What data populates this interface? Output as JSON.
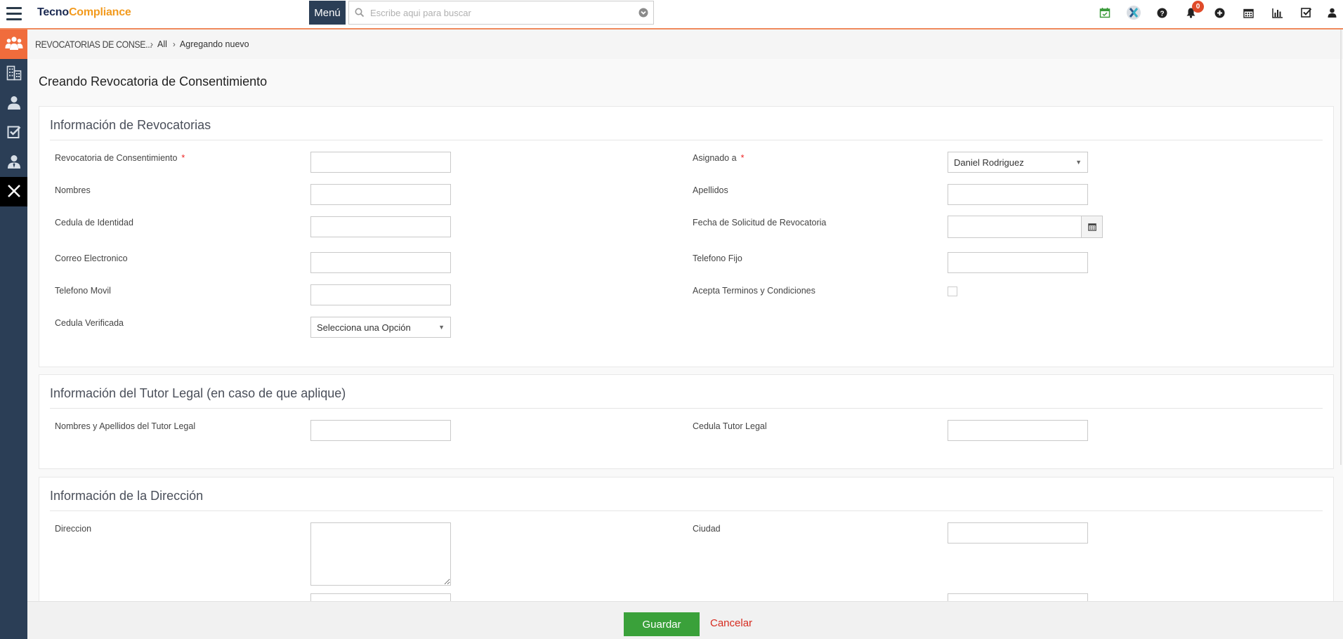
{
  "app": {
    "logo_part1": "Tecno",
    "logo_part2": "Compliance"
  },
  "header": {
    "menu_label": "Menú",
    "search_placeholder": "Escribe aqui para buscar",
    "notifications_count": "0"
  },
  "sidebar": {
    "items": [
      "users-group-icon",
      "buildings-icon",
      "user-icon",
      "checklist-icon",
      "user-tie-icon",
      "close-icon"
    ]
  },
  "breadcrumb": {
    "module": "REVOCATORIAS DE CONSE...",
    "all": "All",
    "current": "Agregando nuevo"
  },
  "page": {
    "title": "Creando Revocatoria de Consentimiento"
  },
  "section1": {
    "title": "Información de Revocatorias",
    "revocatoria_label": "Revocatoria de Consentimiento",
    "asignado_label": "Asignado a",
    "asignado_value": "Daniel Rodriguez",
    "nombres_label": "Nombres",
    "apellidos_label": "Apellidos",
    "cedula_label": "Cedula de Identidad",
    "fecha_label": "Fecha de Solicitud de Revocatoria",
    "correo_label": "Correo Electronico",
    "telefono_fijo_label": "Telefono Fijo",
    "telefono_movil_label": "Telefono Movil",
    "acepta_label": "Acepta Terminos y Condiciones",
    "cedula_verificada_label": "Cedula Verificada",
    "cedula_verificada_value": "Selecciona una Opción"
  },
  "section2": {
    "title": "Información del Tutor Legal (en caso de que aplique)",
    "tutor_nombres_label": "Nombres y Apellidos del Tutor Legal",
    "tutor_cedula_label": "Cedula Tutor Legal"
  },
  "section3": {
    "title": "Información de la Dirección",
    "direccion_label": "Direccion",
    "ciudad_label": "Ciudad"
  },
  "footer": {
    "save_label": "Guardar",
    "cancel_label": "Cancelar"
  },
  "colors": {
    "accent": "#f06c3c",
    "sidebar": "#2b3e56",
    "save": "#3aa13a",
    "cancel": "#d62b1f"
  }
}
